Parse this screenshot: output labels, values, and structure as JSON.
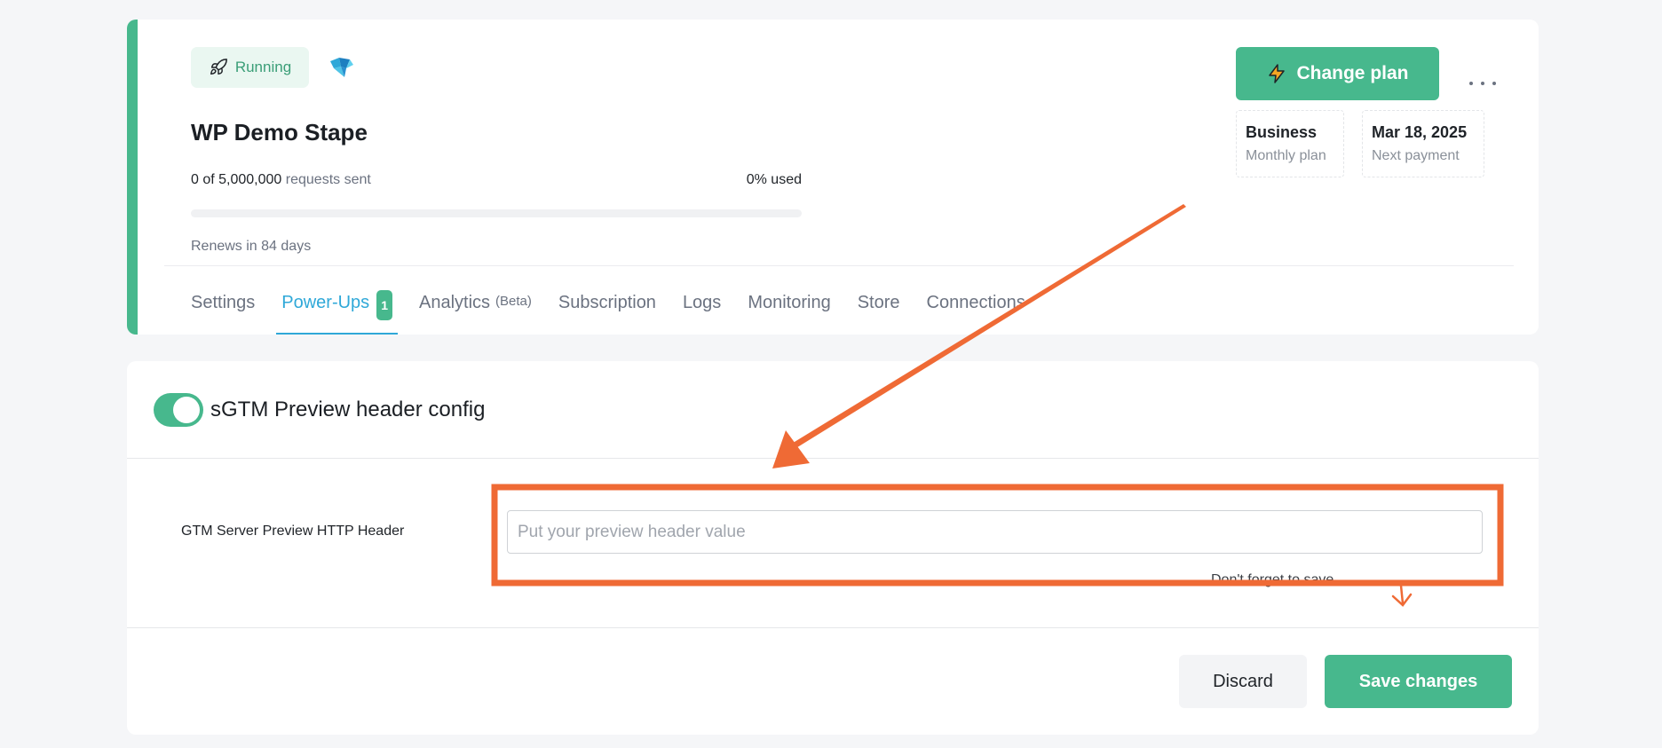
{
  "container": {
    "status": "Running",
    "brand_logo": "stape-logo",
    "name": "WP Demo Stape",
    "usage": {
      "count_text": "0 of 5,000,000",
      "suffix": "requests sent",
      "percent_text": "0% used",
      "fraction": 0
    },
    "renews": "Renews in 84 days",
    "change_plan_label": "Change plan",
    "plan": {
      "value": "Business",
      "label": "Monthly plan"
    },
    "payment": {
      "value": "Mar 18, 2025",
      "label": "Next payment"
    }
  },
  "tabs": [
    {
      "label": "Settings"
    },
    {
      "label": "Power-Ups",
      "badge": "1",
      "active": true
    },
    {
      "label": "Analytics",
      "extra": "(Beta)"
    },
    {
      "label": "Subscription"
    },
    {
      "label": "Logs"
    },
    {
      "label": "Monitoring"
    },
    {
      "label": "Store"
    },
    {
      "label": "Connections"
    }
  ],
  "powerup": {
    "title": "sGTM Preview header config",
    "enabled": true,
    "field_label": "GTM Server Preview HTTP Header",
    "field_value": "",
    "field_placeholder": "Put your preview header value",
    "save_hint": "Don't forget to save",
    "discard_label": "Discard",
    "save_label": "Save changes"
  },
  "colors": {
    "accent_green": "#47b88d",
    "active_tab_blue": "#2fa8d8",
    "annotation_orange": "#ef6a35"
  }
}
